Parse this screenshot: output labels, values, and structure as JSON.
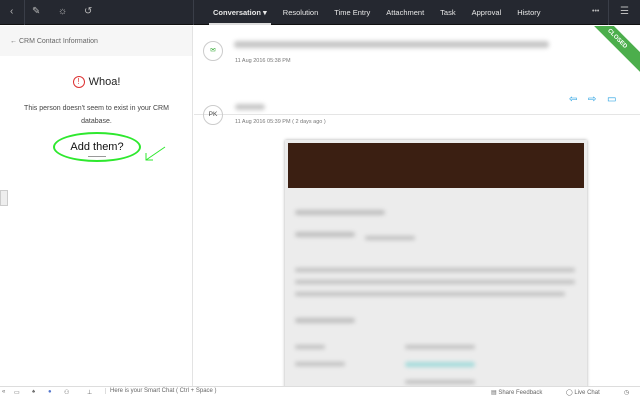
{
  "topbar": {
    "tabs": [
      {
        "label": "Conversation",
        "active": true
      },
      {
        "label": "Resolution"
      },
      {
        "label": "Time Entry"
      },
      {
        "label": "Attachment"
      },
      {
        "label": "Task"
      },
      {
        "label": "Approval"
      },
      {
        "label": "History"
      }
    ],
    "more": "•••"
  },
  "left": {
    "header": "CRM Contact Information",
    "title": "Whoa!",
    "message": "This person doesn't seem to exist in your CRM database.",
    "add": "Add them?"
  },
  "thread": [
    {
      "timestamp": "11 Aug 2016 05:38 PM"
    },
    {
      "initials": "PK",
      "timestamp": "11 Aug 2016 05:39 PM ( 2 days ago )"
    }
  ],
  "status": "CLOSED",
  "bottom": {
    "smartchat": "Here is your Smart Chat ( Ctrl + Space )",
    "feedback": "Share Feedback",
    "livechat": "Live Chat"
  },
  "colors": {
    "accent": "#1a9be0",
    "closed": "#4cae4c",
    "highlight": "#2ee82e"
  }
}
